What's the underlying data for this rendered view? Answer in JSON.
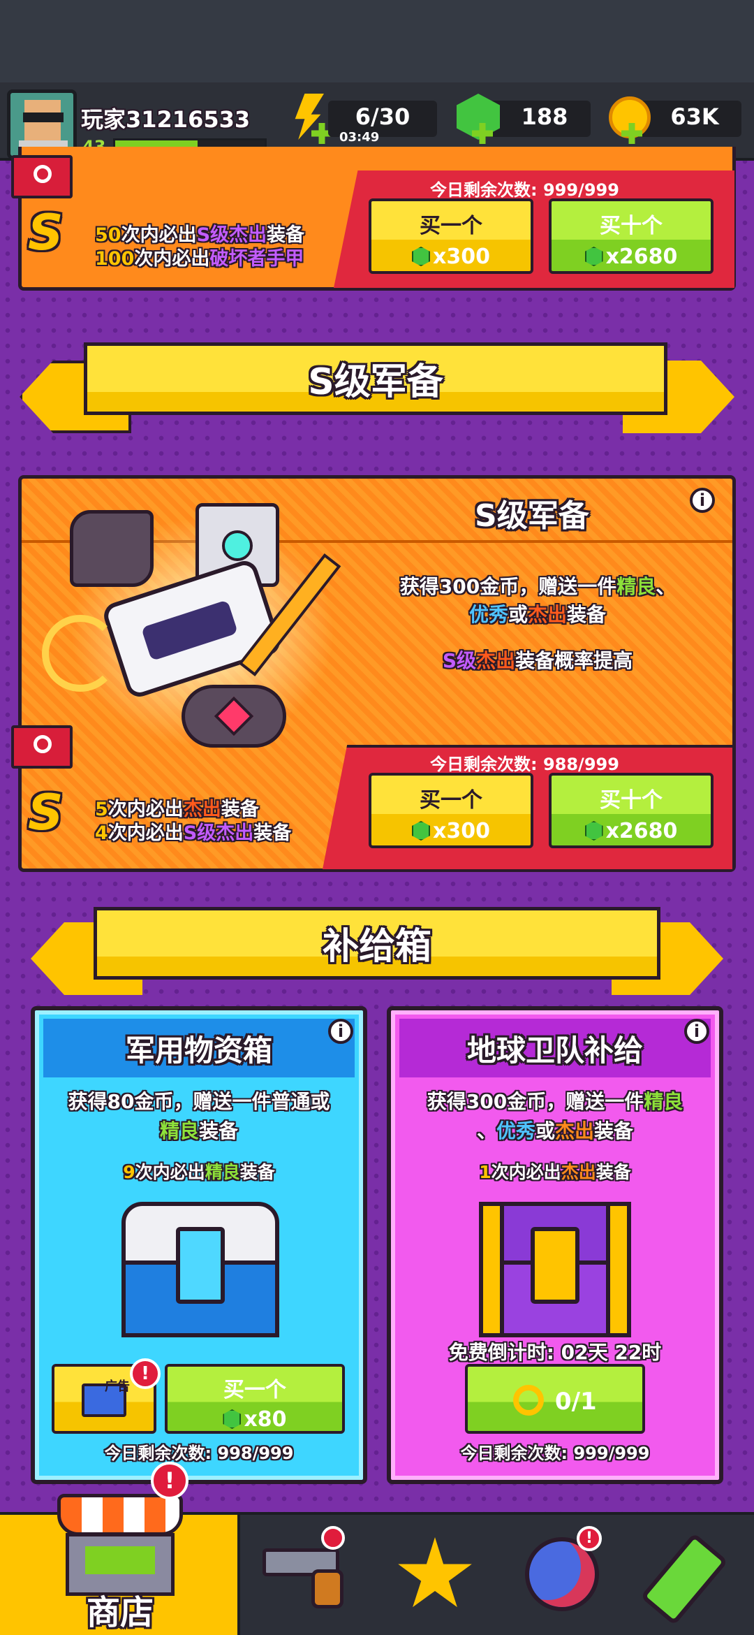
{
  "player": {
    "name": "玩家31216533",
    "level": "43",
    "level_progress": 0.55
  },
  "resources": {
    "energy": "6/30",
    "energy_timer": "03:49",
    "gems": "188",
    "coins": "63K"
  },
  "top_card": {
    "remaining": "今日剩余次数: 999/999",
    "guarantee_1_num": "50",
    "guarantee_1_a": "次内必出",
    "guarantee_1_b": "S级杰出",
    "guarantee_1_c": "装备",
    "guarantee_2_num": "100",
    "guarantee_2_a": "次内必出",
    "guarantee_2_b": "破坏者手甲",
    "buy_one": "买一个",
    "buy_one_price": "x300",
    "buy_ten": "买十个",
    "buy_ten_price": "x2680"
  },
  "section_s": {
    "title": "S级军备"
  },
  "s_card": {
    "title": "S级军备",
    "desc_1": "获得300金币，赠送一件",
    "desc_hl1": "精良",
    "desc_sep": "、",
    "desc_hl2": "优秀",
    "desc_or": "或",
    "desc_hl3": "杰出",
    "desc_end": "装备",
    "boost_a": "S级",
    "boost_b": "杰出",
    "boost_c": "装备概率提高",
    "remaining": "今日剩余次数: 988/999",
    "g1_num": "5",
    "g1_a": "次内必出",
    "g1_b": "杰出",
    "g1_c": "装备",
    "g2_num": "4",
    "g2_a": "次内必出",
    "g2_b": "S级杰出",
    "g2_c": "装备",
    "buy_one": "买一个",
    "buy_one_price": "x300",
    "buy_ten": "买十个",
    "buy_ten_price": "x2680"
  },
  "section_supply": {
    "title": "补给箱"
  },
  "military_box": {
    "title": "军用物资箱",
    "desc_1": "获得80金币，赠送一件普通或",
    "desc_hl": "精良",
    "desc_end": "装备",
    "guarantee_num": "9",
    "guarantee_a": "次内必出",
    "guarantee_b": "精良",
    "guarantee_c": "装备",
    "ad_label": "广告",
    "buy_one": "买一个",
    "price": "x80",
    "remaining": "今日剩余次数: 998/999"
  },
  "earth_box": {
    "title": "地球卫队补给",
    "desc_1": "获得300金币，赠送一件",
    "desc_hl1": "精良",
    "desc_2": "、",
    "desc_hl2": "优秀",
    "desc_or": "或",
    "desc_hl3": "杰出",
    "desc_end": "装备",
    "guarantee_num": "1",
    "guarantee_a": "次内必出",
    "guarantee_b": "杰出",
    "guarantee_c": "装备",
    "countdown": "免费倒计时: 02天 22时",
    "keys": "0/1",
    "remaining": "今日剩余次数: 999/999"
  },
  "nav": {
    "shop": "商店"
  },
  "colors": {
    "green": "#8ee23a",
    "blue": "#4fc3ff",
    "orange": "#ff8a1c",
    "purple": "#c35cff",
    "pink": "#ff5acd"
  }
}
